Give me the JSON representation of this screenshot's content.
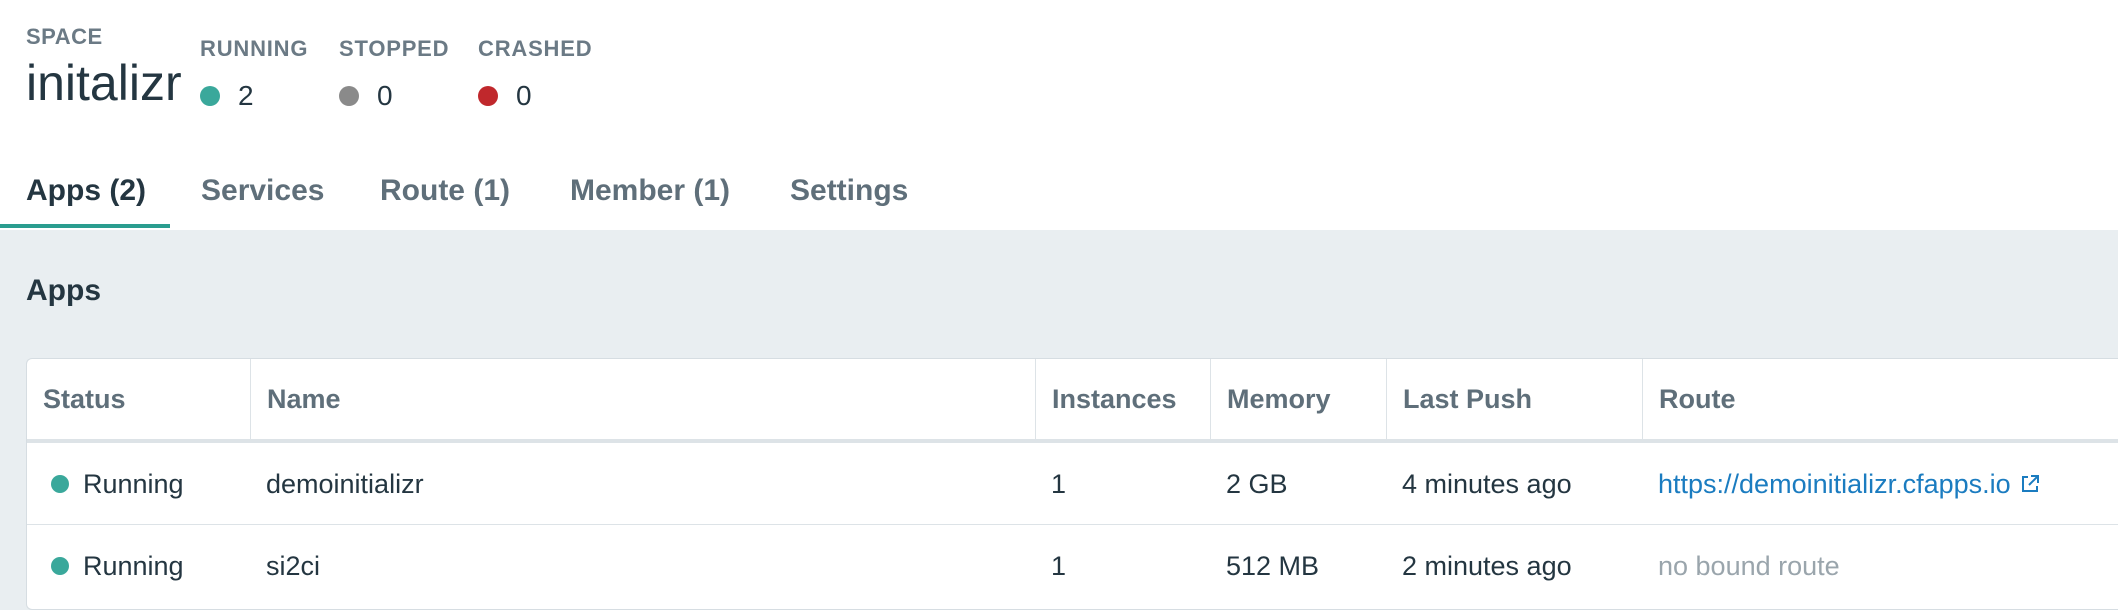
{
  "space": {
    "label": "SPACE",
    "name": "initalizr"
  },
  "stats": {
    "running": {
      "label": "RUNNING",
      "count": "2",
      "color": "#3aa89b"
    },
    "stopped": {
      "label": "STOPPED",
      "count": "0",
      "color": "#8a8a8a"
    },
    "crashed": {
      "label": "CRASHED",
      "count": "0",
      "color": "#c0282c"
    }
  },
  "tabs": [
    {
      "label": "Apps (2)",
      "active": true
    },
    {
      "label": "Services",
      "active": false
    },
    {
      "label": "Route (1)",
      "active": false
    },
    {
      "label": "Member (1)",
      "active": false
    },
    {
      "label": "Settings",
      "active": false
    }
  ],
  "apps_section": {
    "title": "Apps",
    "columns": [
      "Status",
      "Name",
      "Instances",
      "Memory",
      "Last Push",
      "Route"
    ],
    "rows": [
      {
        "status": "Running",
        "status_color": "#3aa89b",
        "name": "demoinitializr",
        "instances": "1",
        "memory": "2 GB",
        "last_push": "4 minutes ago",
        "route": "https://demoinitializr.cfapps.io",
        "route_icon": "external-link-icon"
      },
      {
        "status": "Running",
        "status_color": "#3aa89b",
        "name": "si2ci",
        "instances": "1",
        "memory": "512 MB",
        "last_push": "2 minutes ago",
        "route": "no bound route"
      }
    ]
  }
}
